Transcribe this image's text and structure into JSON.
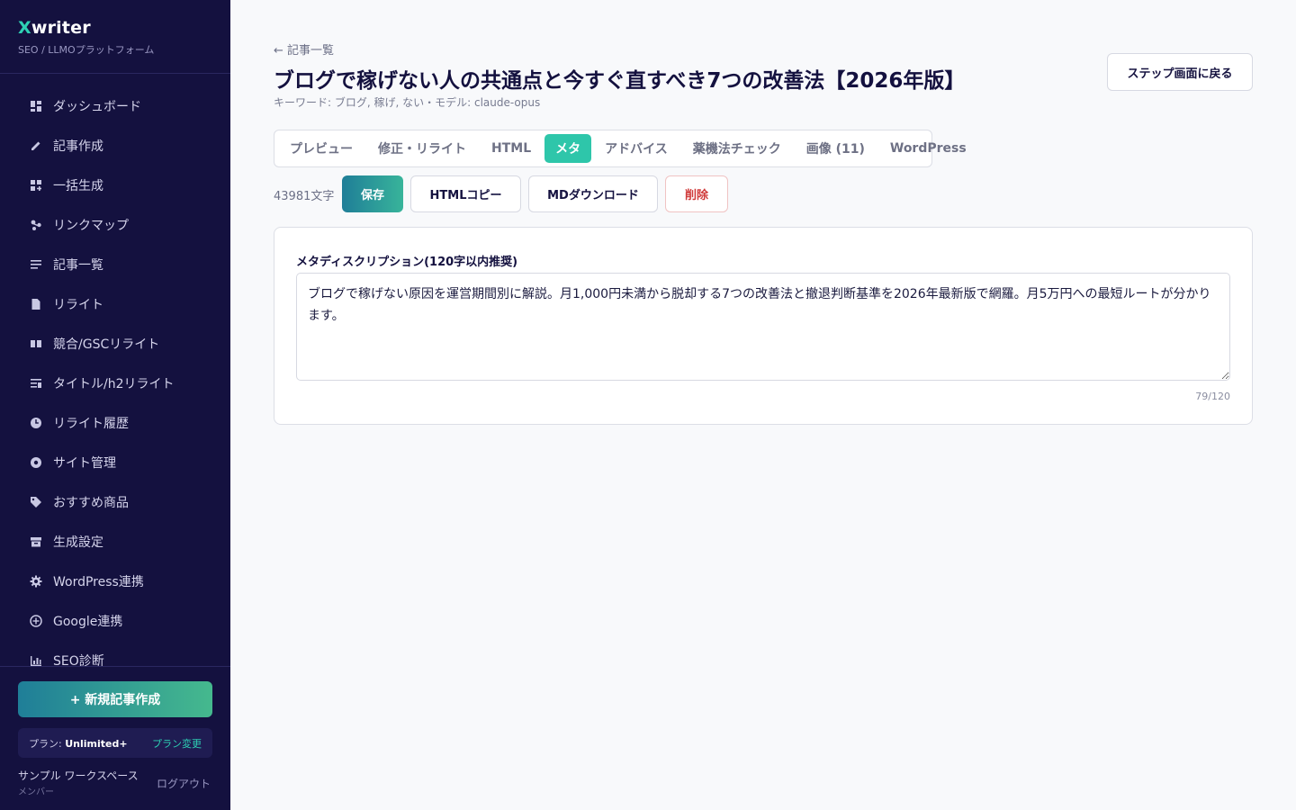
{
  "sidebar": {
    "brand_x": "X",
    "brand_rest": "writer",
    "brand_sub": "SEO / LLMOプラットフォーム",
    "items": [
      {
        "label": "ダッシュボード",
        "icon": "dashboard-icon"
      },
      {
        "label": "記事作成",
        "icon": "pencil-icon"
      },
      {
        "label": "一括生成",
        "icon": "grid-plus-icon"
      },
      {
        "label": "リンクマップ",
        "icon": "link-map-icon"
      },
      {
        "label": "記事一覧",
        "icon": "list-icon"
      },
      {
        "label": "リライト",
        "icon": "document-icon"
      },
      {
        "label": "競合/GSCリライト",
        "icon": "book-open-icon"
      },
      {
        "label": "タイトル/h2リライト",
        "icon": "heading-icon"
      },
      {
        "label": "リライト履歴",
        "icon": "clock-icon"
      },
      {
        "label": "サイト管理",
        "icon": "compass-icon"
      },
      {
        "label": "おすすめ商品",
        "icon": "tag-icon"
      },
      {
        "label": "生成設定",
        "icon": "archive-icon"
      },
      {
        "label": "WordPress連携",
        "icon": "gear-icon"
      },
      {
        "label": "Google連携",
        "icon": "plus-circle-icon"
      },
      {
        "label": "SEO診断",
        "icon": "chart-icon"
      }
    ],
    "new_article": "+ 新規記事作成",
    "plan_prefix": "プラン: ",
    "plan_name": "Unlimited+",
    "plan_change": "プラン変更",
    "user_name": "サンプル ワークスペース",
    "user_role": "メンバー",
    "logout": "ログアウト"
  },
  "header": {
    "back_link": "← 記事一覧",
    "title": "ブログで稼げない人の共通点と今すぐ直すべき7つの改善法【2026年版】",
    "meta": "キーワード: ブログ, 稼げ, ない・モデル: claude-opus",
    "back_step": "ステップ画面に戻る"
  },
  "tabs": [
    {
      "label": "プレビュー",
      "active": false
    },
    {
      "label": "修正・リライト",
      "active": false
    },
    {
      "label": "HTML",
      "active": false
    },
    {
      "label": "メタ",
      "active": true
    },
    {
      "label": "アドバイス",
      "active": false
    },
    {
      "label": "薬機法チェック",
      "active": false
    },
    {
      "label": "画像 (11)",
      "active": false
    },
    {
      "label": "WordPress",
      "active": false
    }
  ],
  "toolbar": {
    "char_count": "43981文字",
    "save": "保存",
    "html_copy": "HTMLコピー",
    "md_download": "MDダウンロード",
    "delete": "削除"
  },
  "meta_panel": {
    "label": "メタディスクリプション(120字以内推奨)",
    "value": "ブログで稼げない原因を運営期間別に解説。月1,000円未満から脱却する7つの改善法と撤退判断基準を2026年最新版で網羅。月5万円への最短ルートが分かります。",
    "counter": "79/120"
  },
  "colors": {
    "sidebar_bg": "#14113f",
    "accent": "#2ec6aa",
    "danger": "#d03a3a"
  }
}
